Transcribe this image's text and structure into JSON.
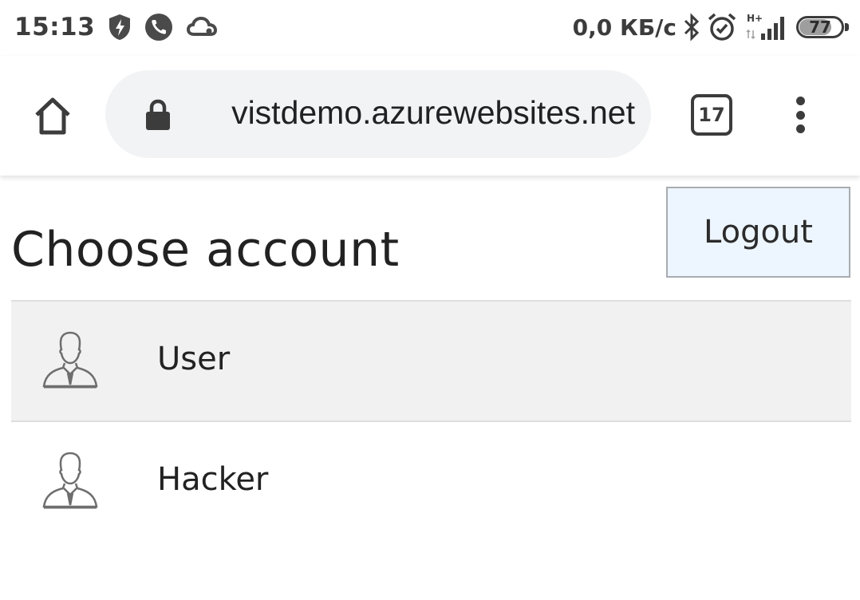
{
  "status_bar": {
    "time": "15:13",
    "net_speed": "0,0 КБ/с",
    "battery_level": "77",
    "network_type": "H+",
    "icons": [
      "shield-bolt-icon",
      "phone-icon",
      "cloud-icon",
      "bluetooth-icon",
      "alarm-icon",
      "signal-icon",
      "battery-icon"
    ]
  },
  "browser": {
    "url": "vistdemo.azurewebsites.net",
    "tab_count": "17",
    "icons": [
      "home-icon",
      "lock-icon",
      "tab-switcher-icon",
      "more-menu-icon"
    ]
  },
  "page": {
    "title": "Choose account",
    "logout_label": "Logout",
    "accounts": [
      {
        "name": "User",
        "selected": true,
        "icon": "user-avatar-icon"
      },
      {
        "name": "Hacker",
        "selected": false,
        "icon": "user-avatar-icon"
      }
    ]
  },
  "colors": {
    "logout_background": "#edf5fe",
    "selected_row_background": "#f1f1f1",
    "omnibox_background": "#f1f3f4",
    "icon_dark": "#3c3c3c"
  }
}
